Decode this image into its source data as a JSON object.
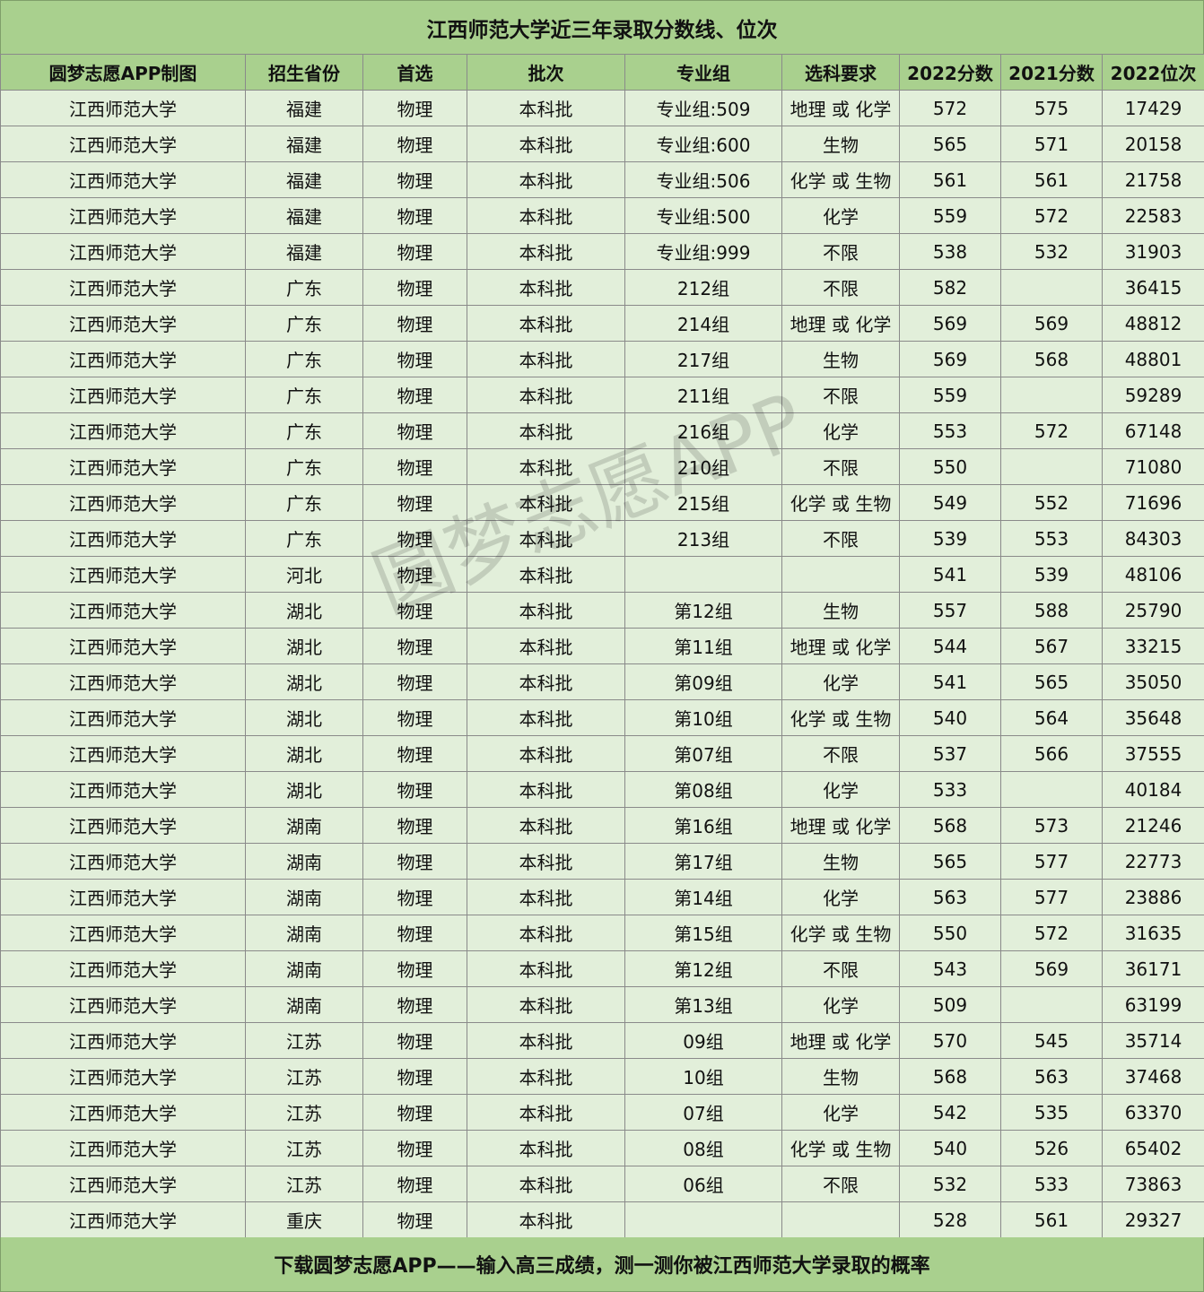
{
  "title": "江西师范大学近三年录取分数线、位次",
  "columns": [
    "圆梦志愿APP制图",
    "招生省份",
    "首选",
    "批次",
    "专业组",
    "选科要求",
    "2022分数",
    "2021分数",
    "2022位次"
  ],
  "rows": [
    [
      "江西师范大学",
      "福建",
      "物理",
      "本科批",
      "专业组:509",
      "地理 或 化学",
      "572",
      "575",
      "17429"
    ],
    [
      "江西师范大学",
      "福建",
      "物理",
      "本科批",
      "专业组:600",
      "生物",
      "565",
      "571",
      "20158"
    ],
    [
      "江西师范大学",
      "福建",
      "物理",
      "本科批",
      "专业组:506",
      "化学 或 生物",
      "561",
      "561",
      "21758"
    ],
    [
      "江西师范大学",
      "福建",
      "物理",
      "本科批",
      "专业组:500",
      "化学",
      "559",
      "572",
      "22583"
    ],
    [
      "江西师范大学",
      "福建",
      "物理",
      "本科批",
      "专业组:999",
      "不限",
      "538",
      "532",
      "31903"
    ],
    [
      "江西师范大学",
      "广东",
      "物理",
      "本科批",
      "212组",
      "不限",
      "582",
      "",
      "36415"
    ],
    [
      "江西师范大学",
      "广东",
      "物理",
      "本科批",
      "214组",
      "地理 或 化学",
      "569",
      "569",
      "48812"
    ],
    [
      "江西师范大学",
      "广东",
      "物理",
      "本科批",
      "217组",
      "生物",
      "569",
      "568",
      "48801"
    ],
    [
      "江西师范大学",
      "广东",
      "物理",
      "本科批",
      "211组",
      "不限",
      "559",
      "",
      "59289"
    ],
    [
      "江西师范大学",
      "广东",
      "物理",
      "本科批",
      "216组",
      "化学",
      "553",
      "572",
      "67148"
    ],
    [
      "江西师范大学",
      "广东",
      "物理",
      "本科批",
      "210组",
      "不限",
      "550",
      "",
      "71080"
    ],
    [
      "江西师范大学",
      "广东",
      "物理",
      "本科批",
      "215组",
      "化学 或 生物",
      "549",
      "552",
      "71696"
    ],
    [
      "江西师范大学",
      "广东",
      "物理",
      "本科批",
      "213组",
      "不限",
      "539",
      "553",
      "84303"
    ],
    [
      "江西师范大学",
      "河北",
      "物理",
      "本科批",
      "",
      "",
      "541",
      "539",
      "48106"
    ],
    [
      "江西师范大学",
      "湖北",
      "物理",
      "本科批",
      "第12组",
      "生物",
      "557",
      "588",
      "25790"
    ],
    [
      "江西师范大学",
      "湖北",
      "物理",
      "本科批",
      "第11组",
      "地理 或 化学",
      "544",
      "567",
      "33215"
    ],
    [
      "江西师范大学",
      "湖北",
      "物理",
      "本科批",
      "第09组",
      "化学",
      "541",
      "565",
      "35050"
    ],
    [
      "江西师范大学",
      "湖北",
      "物理",
      "本科批",
      "第10组",
      "化学 或 生物",
      "540",
      "564",
      "35648"
    ],
    [
      "江西师范大学",
      "湖北",
      "物理",
      "本科批",
      "第07组",
      "不限",
      "537",
      "566",
      "37555"
    ],
    [
      "江西师范大学",
      "湖北",
      "物理",
      "本科批",
      "第08组",
      "化学",
      "533",
      "",
      "40184"
    ],
    [
      "江西师范大学",
      "湖南",
      "物理",
      "本科批",
      "第16组",
      "地理 或 化学",
      "568",
      "573",
      "21246"
    ],
    [
      "江西师范大学",
      "湖南",
      "物理",
      "本科批",
      "第17组",
      "生物",
      "565",
      "577",
      "22773"
    ],
    [
      "江西师范大学",
      "湖南",
      "物理",
      "本科批",
      "第14组",
      "化学",
      "563",
      "577",
      "23886"
    ],
    [
      "江西师范大学",
      "湖南",
      "物理",
      "本科批",
      "第15组",
      "化学 或 生物",
      "550",
      "572",
      "31635"
    ],
    [
      "江西师范大学",
      "湖南",
      "物理",
      "本科批",
      "第12组",
      "不限",
      "543",
      "569",
      "36171"
    ],
    [
      "江西师范大学",
      "湖南",
      "物理",
      "本科批",
      "第13组",
      "化学",
      "509",
      "",
      "63199"
    ],
    [
      "江西师范大学",
      "江苏",
      "物理",
      "本科批",
      "09组",
      "地理 或 化学",
      "570",
      "545",
      "35714"
    ],
    [
      "江西师范大学",
      "江苏",
      "物理",
      "本科批",
      "10组",
      "生物",
      "568",
      "563",
      "37468"
    ],
    [
      "江西师范大学",
      "江苏",
      "物理",
      "本科批",
      "07组",
      "化学",
      "542",
      "535",
      "63370"
    ],
    [
      "江西师范大学",
      "江苏",
      "物理",
      "本科批",
      "08组",
      "化学 或 生物",
      "540",
      "526",
      "65402"
    ],
    [
      "江西师范大学",
      "江苏",
      "物理",
      "本科批",
      "06组",
      "不限",
      "532",
      "533",
      "73863"
    ],
    [
      "江西师范大学",
      "重庆",
      "物理",
      "本科批",
      "",
      "",
      "528",
      "561",
      "29327"
    ]
  ],
  "footer": "下载圆梦志愿APP——输入高三成绩，测一测你被江西师范大学录取的概率",
  "watermark": "圆梦志愿APP",
  "colors": {
    "header_bg": "#a9d08e",
    "cell_bg": "#e2efda",
    "border": "#8a8a8a"
  }
}
